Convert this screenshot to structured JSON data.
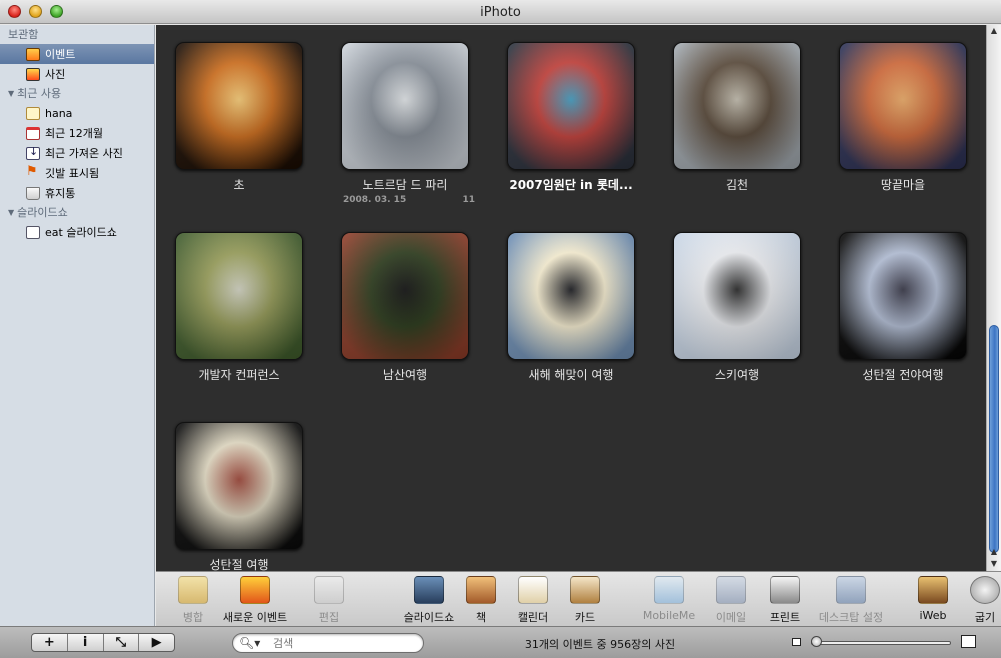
{
  "window": {
    "title": "iPhoto"
  },
  "sidebar": {
    "sections": [
      {
        "header": "보관함",
        "items": [
          {
            "label": "이벤트",
            "icon": "events-icon",
            "selected": true
          },
          {
            "label": "사진",
            "icon": "photos-icon"
          }
        ]
      },
      {
        "header": "최근 사용",
        "items": [
          {
            "label": "hana",
            "icon": "album-icon"
          },
          {
            "label": "최근 12개월",
            "icon": "calendar-icon"
          },
          {
            "label": "최근 가져온 사진",
            "icon": "import-icon"
          },
          {
            "label": "깃발 표시됨",
            "icon": "flag-icon"
          },
          {
            "label": "휴지통",
            "icon": "trash-icon"
          }
        ]
      },
      {
        "header": "슬라이드쇼",
        "items": [
          {
            "label": "eat 슬라이드쇼",
            "icon": "slideshow-icon"
          }
        ]
      }
    ]
  },
  "events": [
    {
      "title": "초",
      "colors": [
        "#1a0c02",
        "#d4701c",
        "#ffd27a"
      ]
    },
    {
      "title": "노트르담 드 파리",
      "date": "2008. 03. 15",
      "count": "11",
      "colors": [
        "#c9cfd6",
        "#8a929c",
        "#e9edf0"
      ]
    },
    {
      "title": "2007임원단 in 롯데...",
      "bold": true,
      "colors": [
        "#2a2f3a",
        "#c8403a",
        "#45a3c8"
      ]
    },
    {
      "title": "김천",
      "colors": [
        "#9fa6ac",
        "#5a4a3a",
        "#c9c3b4"
      ]
    },
    {
      "title": "땅끝마을",
      "colors": [
        "#2b2f52",
        "#d66b3a",
        "#f3b06a"
      ]
    },
    {
      "title": "개발자 컨퍼런스",
      "colors": [
        "#3e5a2a",
        "#9aa05a",
        "#d8d9c8"
      ]
    },
    {
      "title": "남산여행",
      "colors": [
        "#8a3a26",
        "#2a3a1a",
        "#121212"
      ]
    },
    {
      "title": "새해 해맞이 여행",
      "colors": [
        "#6f8fb4",
        "#fff6d8",
        "#1c1d22"
      ]
    },
    {
      "title": "스키여행",
      "colors": [
        "#c9d6e6",
        "#f2f4f8",
        "#2a2a2a"
      ]
    },
    {
      "title": "성탄절 전야여행",
      "colors": [
        "#050505",
        "#b8c4dc",
        "#3a3a4a"
      ]
    },
    {
      "title": "성탄절 여행",
      "colors": [
        "#0a0a0a",
        "#e8e0c8",
        "#a2483a"
      ]
    }
  ],
  "toolbar": {
    "buttons": [
      {
        "label": "병합",
        "icon": "merge-icon",
        "dim": true
      },
      {
        "label": "새로운 이벤트",
        "icon": "new-event-icon"
      },
      {
        "label": "편집",
        "icon": "edit-icon",
        "dim": true
      },
      {
        "label": "슬라이드쇼",
        "icon": "slideshow-icon"
      },
      {
        "label": "책",
        "icon": "book-icon"
      },
      {
        "label": "캘린더",
        "icon": "calendar-icon"
      },
      {
        "label": "카드",
        "icon": "card-icon"
      },
      {
        "label": "MobileMe",
        "icon": "mobileme-icon",
        "dim": true
      },
      {
        "label": "이메일",
        "icon": "email-icon",
        "dim": true
      },
      {
        "label": "프린트",
        "icon": "print-icon"
      },
      {
        "label": "데스크탑 설정",
        "icon": "desktop-icon",
        "dim": true
      },
      {
        "label": "iWeb",
        "icon": "iweb-icon"
      },
      {
        "label": "굽기",
        "icon": "burn-icon"
      }
    ]
  },
  "bottombar": {
    "buttons": [
      "+",
      "i",
      "⤡",
      "▶"
    ],
    "search_placeholder": "검색",
    "status": "31개의 이벤트 중 956장의 사진"
  }
}
